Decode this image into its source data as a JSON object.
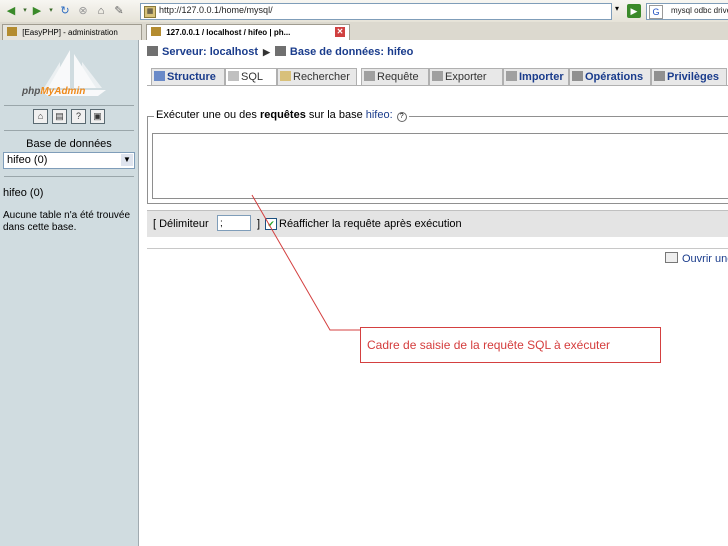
{
  "browser": {
    "url": "http://127.0.0.1/home/mysql/",
    "search_text": "mysql odbc driver",
    "tabs": [
      {
        "label": "[EasyPHP] - administration"
      },
      {
        "label": "127.0.0.1 / localhost / hifeo | ph..."
      }
    ]
  },
  "left": {
    "logo": {
      "php": "php",
      "myadmin": "MyAdmin"
    },
    "db_label": "Base de données",
    "db_selected": "hifeo (0)",
    "db_current": "hifeo (0)",
    "no_table": "Aucune table n'a été trouvée dans cette base."
  },
  "main": {
    "breadcrumb": {
      "server": "Serveur: localhost",
      "database": "Base de données: hifeo"
    },
    "tabs": [
      {
        "label": "Structure"
      },
      {
        "label": "SQL"
      },
      {
        "label": "Rechercher"
      },
      {
        "label": "Requête"
      },
      {
        "label": "Exporter"
      },
      {
        "label": "Importer"
      },
      {
        "label": "Opérations"
      },
      {
        "label": "Privilèges"
      }
    ],
    "query_box": {
      "legend_pre": "Exécuter une ou des ",
      "legend_bold": "requêtes",
      "legend_mid": " sur la base ",
      "legend_db": "hifeo:"
    },
    "options": {
      "delimiter_label": "[ Délimiteur",
      "delimiter_value": ";",
      "close_bracket": "]",
      "redisplay_label": "Réafficher la requête après exécution"
    },
    "open_link": "Ouvrir une"
  },
  "annotation": {
    "text": "Cadre de saisie de la requête SQL à exécuter",
    "color": "#d43c3c"
  }
}
